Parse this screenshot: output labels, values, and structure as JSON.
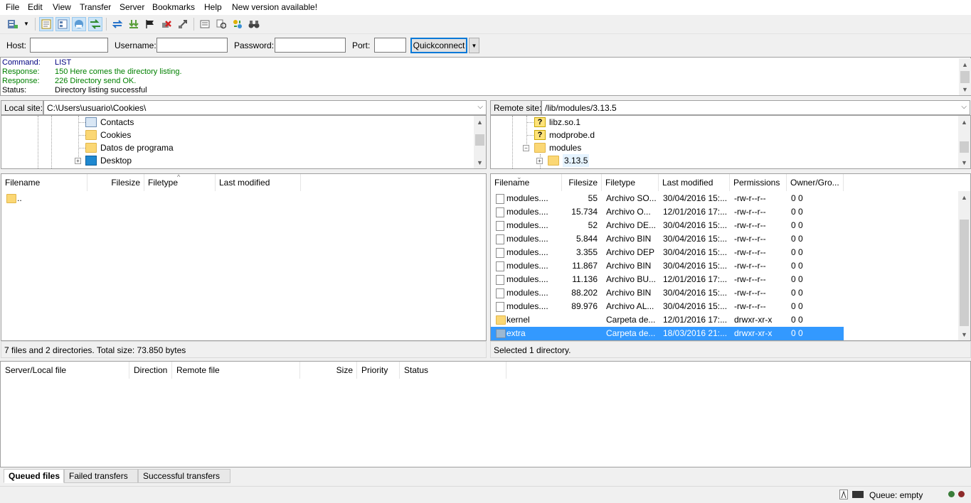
{
  "menu": [
    "File",
    "Edit",
    "View",
    "Transfer",
    "Server",
    "Bookmarks",
    "Help",
    "New version available!"
  ],
  "toolbar": {
    "icons": [
      "site-manager-icon",
      "dropdown-arrow-icon",
      "message-log-icon",
      "local-tree-icon",
      "remote-tree-icon",
      "transfer-queue-icon",
      "refresh-icon",
      "process-queue-icon",
      "cancel-operation-icon",
      "disconnect-icon",
      "reconnect-icon",
      "directory-listing-filters-icon",
      "toggle-sync-browsing-icon",
      "compare-directories-icon",
      "search-remote-files-icon"
    ]
  },
  "quickconnect": {
    "host_label": "Host:",
    "host_value": "",
    "username_label": "Username:",
    "username_value": "",
    "password_label": "Password:",
    "password_value": "",
    "port_label": "Port:",
    "port_value": "",
    "button": "Quickconnect"
  },
  "log": [
    {
      "k": "Command:",
      "v": "LIST",
      "cls": "c-cmd"
    },
    {
      "k": "Response:",
      "v": "150 Here comes the directory listing.",
      "cls": "c-resp"
    },
    {
      "k": "Response:",
      "v": "226 Directory send OK.",
      "cls": "c-resp"
    },
    {
      "k": "Status:",
      "v": "Directory listing successful",
      "cls": "c-stat"
    }
  ],
  "local": {
    "site_label": "Local site:",
    "path": "C:\\Users\\usuario\\Cookies\\",
    "tree": [
      {
        "label": "Contacts",
        "icon": "contacts-icon"
      },
      {
        "label": "Cookies",
        "icon": "folder-icon"
      },
      {
        "label": "Datos de programa",
        "icon": "folder-icon"
      },
      {
        "label": "Desktop",
        "icon": "desktop-icon"
      }
    ],
    "columns": [
      "Filename",
      "Filesize",
      "Filetype",
      "Last modified"
    ],
    "files": [
      {
        "name": "..",
        "size": "",
        "type": "",
        "modified": ""
      }
    ],
    "status": "7 files and 2 directories. Total size: 73.850 bytes"
  },
  "remote": {
    "site_label": "Remote site:",
    "path": "/lib/modules/3.13.5",
    "tree": [
      {
        "label": "libz.so.1",
        "icon": "unknown-icon"
      },
      {
        "label": "modprobe.d",
        "icon": "unknown-icon"
      },
      {
        "label": "modules",
        "icon": "folder-icon"
      },
      {
        "label": "3.13.5",
        "icon": "folder-icon"
      }
    ],
    "columns": [
      "Filename",
      "Filesize",
      "Filetype",
      "Last modified",
      "Permissions",
      "Owner/Gro..."
    ],
    "files": [
      {
        "name": "modules....",
        "size": "55",
        "type": "Archivo SO...",
        "modified": "30/04/2016 15:...",
        "perm": "-rw-r--r--",
        "owner": "0 0",
        "kind": "file"
      },
      {
        "name": "modules....",
        "size": "15.734",
        "type": "Archivo O...",
        "modified": "12/01/2016 17:...",
        "perm": "-rw-r--r--",
        "owner": "0 0",
        "kind": "file"
      },
      {
        "name": "modules....",
        "size": "52",
        "type": "Archivo DE...",
        "modified": "30/04/2016 15:...",
        "perm": "-rw-r--r--",
        "owner": "0 0",
        "kind": "file"
      },
      {
        "name": "modules....",
        "size": "5.844",
        "type": "Archivo BIN",
        "modified": "30/04/2016 15:...",
        "perm": "-rw-r--r--",
        "owner": "0 0",
        "kind": "file"
      },
      {
        "name": "modules....",
        "size": "3.355",
        "type": "Archivo DEP",
        "modified": "30/04/2016 15:...",
        "perm": "-rw-r--r--",
        "owner": "0 0",
        "kind": "file"
      },
      {
        "name": "modules....",
        "size": "11.867",
        "type": "Archivo BIN",
        "modified": "30/04/2016 15:...",
        "perm": "-rw-r--r--",
        "owner": "0 0",
        "kind": "file"
      },
      {
        "name": "modules....",
        "size": "11.136",
        "type": "Archivo BU...",
        "modified": "12/01/2016 17:...",
        "perm": "-rw-r--r--",
        "owner": "0 0",
        "kind": "file"
      },
      {
        "name": "modules....",
        "size": "88.202",
        "type": "Archivo BIN",
        "modified": "30/04/2016 15:...",
        "perm": "-rw-r--r--",
        "owner": "0 0",
        "kind": "file"
      },
      {
        "name": "modules....",
        "size": "89.976",
        "type": "Archivo AL...",
        "modified": "30/04/2016 15:...",
        "perm": "-rw-r--r--",
        "owner": "0 0",
        "kind": "file"
      },
      {
        "name": "kernel",
        "size": "",
        "type": "Carpeta de...",
        "modified": "12/01/2016 17:...",
        "perm": "drwxr-xr-x",
        "owner": "0 0",
        "kind": "folder"
      },
      {
        "name": "extra",
        "size": "",
        "type": "Carpeta de...",
        "modified": "18/03/2016 21:...",
        "perm": "drwxr-xr-x",
        "owner": "0 0",
        "kind": "folder",
        "selected": true
      }
    ],
    "status": "Selected 1 directory."
  },
  "queue": {
    "columns": [
      "Server/Local file",
      "Direction",
      "Remote file",
      "Size",
      "Priority",
      "Status"
    ],
    "tabs": [
      "Queued files",
      "Failed transfers",
      "Successful transfers"
    ]
  },
  "statusbar": {
    "queue": "Queue: empty"
  },
  "colors": {
    "selection": "#3399ff",
    "command": "#000080",
    "response": "#008000"
  }
}
